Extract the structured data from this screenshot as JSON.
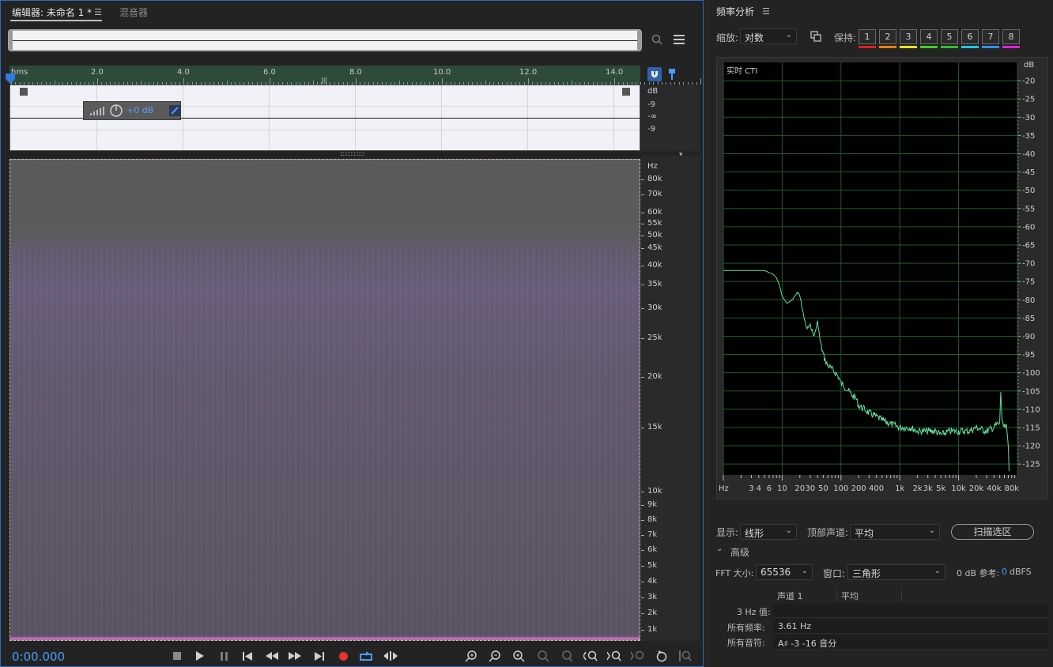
{
  "editor": {
    "tabs": [
      {
        "label": "编辑器: 未命名 1 *",
        "active": true
      },
      {
        "label": "混音器",
        "active": false
      }
    ],
    "ruler": {
      "ticks": [
        "hms",
        "2.0",
        "4.0",
        "6.0",
        "8.0",
        "10.0",
        "12.0",
        "14.0"
      ]
    },
    "hud": {
      "gain": "+0 dB"
    },
    "db_scale": [
      "dB",
      "-9",
      "-∞",
      "-9"
    ],
    "hz_scale": [
      "Hz",
      "80k",
      "70k",
      "60k",
      "55k",
      "50k",
      "45k",
      "40k",
      "35k",
      "30k",
      "25k",
      "20k",
      "15k",
      "10k",
      "9k",
      "8k",
      "7k",
      "6k",
      "5k",
      "4k",
      "3k",
      "2k",
      "1k"
    ],
    "time_display": "0:00.000",
    "accent_color": "#4b9bff"
  },
  "freq": {
    "title": "频率分析",
    "zoom_label": "缩放:",
    "zoom_value": "对数",
    "hold_label": "保持:",
    "hold_buttons": [
      "1",
      "2",
      "3",
      "4",
      "5",
      "6",
      "7",
      "8"
    ],
    "hold_colors": [
      "#e02020",
      "#f08010",
      "#f0e020",
      "#40d020",
      "#30c030",
      "#20c8e8",
      "#3090f0",
      "#e020e0"
    ],
    "graph_overlay": "实时 CTI",
    "display_label": "显示:",
    "display_value": "线形",
    "top_channel_label": "顶部声道:",
    "top_channel_value": "平均",
    "scan_button": "扫描选区",
    "advanced_label": "高级",
    "fft_label": "FFT 大小:",
    "fft_value": "65536",
    "window_label": "窗口:",
    "window_value": "三角形",
    "ref_label": "0 dB 参考:",
    "ref_value": "0",
    "ref_unit": "dBFS",
    "table": {
      "columns": [
        "声道 1",
        "平均"
      ],
      "rows": [
        {
          "label": "3 Hz 值:",
          "value": ""
        },
        {
          "label": "所有频率:",
          "value": "3.61 Hz"
        },
        {
          "label": "所有音符:",
          "value": "A♯ -3 -16 音分"
        }
      ]
    },
    "chart_data": {
      "type": "line",
      "xscale": "log",
      "xlabel": "Hz",
      "ylabel": "dB",
      "x_tick_labels": [
        "Hz",
        "3",
        "4",
        "6",
        "10",
        "20",
        "30",
        "50",
        "100",
        "200",
        "400",
        "1k",
        "2k",
        "3k",
        "5k",
        "10k",
        "20k",
        "40k",
        "80k"
      ],
      "y_tick_labels": [
        "dB",
        "-20",
        "-25",
        "-30",
        "-35",
        "-40",
        "-45",
        "-50",
        "-55",
        "-60",
        "-65",
        "-70",
        "-75",
        "-80",
        "-85",
        "-90",
        "-95",
        "-100",
        "-105",
        "-110",
        "-115",
        "-120",
        "-125"
      ],
      "ylim": [
        -128,
        -15
      ],
      "xlim": [
        1,
        100000
      ],
      "grid": true,
      "line_color": "#5fe0a0",
      "series": [
        {
          "x": [
            1,
            2,
            3,
            5,
            7,
            8,
            9,
            10,
            12,
            15,
            18,
            20,
            23,
            26,
            30,
            35,
            40,
            45,
            50,
            55,
            60,
            70,
            80,
            90,
            100,
            120,
            150,
            180,
            200,
            250,
            300,
            400,
            500,
            700,
            1000,
            1500,
            2000,
            3000,
            4000,
            5000,
            7000,
            10000,
            15000,
            20000,
            30000,
            40000,
            45000,
            50000,
            52000,
            55000,
            60000,
            65000,
            70000,
            72000
          ],
          "y": [
            -72,
            -72,
            -72,
            -72,
            -73,
            -74,
            -76,
            -79,
            -81,
            -80,
            -78,
            -79,
            -84,
            -88,
            -87,
            -90,
            -86,
            -92,
            -95,
            -97,
            -98,
            -99,
            -100,
            -101,
            -103,
            -104,
            -106,
            -107,
            -109,
            -110,
            -111,
            -112,
            -113,
            -114,
            -115,
            -115,
            -116,
            -116,
            -116,
            -117,
            -116,
            -116,
            -116,
            -115,
            -116,
            -115,
            -114,
            -114,
            -105,
            -114,
            -115,
            -115,
            -120,
            -127
          ]
        }
      ]
    }
  }
}
